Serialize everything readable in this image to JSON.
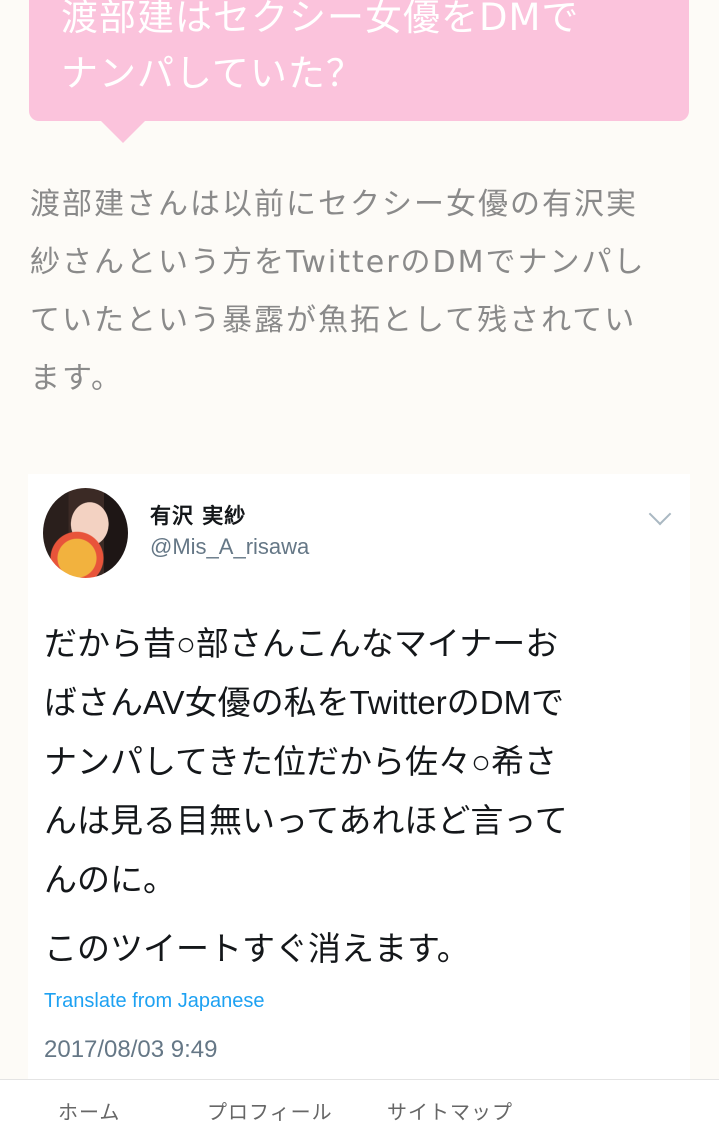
{
  "heading": {
    "lines": [
      "渡部建はセクシー女優をDMで",
      "ナンパしていた？"
    ]
  },
  "article": {
    "lines": [
      "渡部建さんは以前にセクシー女優の有沢実",
      "紗さんという方をTwitterのDMでナンパし",
      "ていたという暴露が魚拓として残されてい",
      "ます。"
    ]
  },
  "tweet": {
    "user_name": "有沢 実紗",
    "handle": "@Mis_A_risawa",
    "text_lines": [
      "だから昔○部さんこんなマイナーお",
      "ばさんAV女優の私をTwitterのDMで",
      "ナンパしてきた位だから佐々○希さ",
      "んは見る目無いってあれほど言って",
      "んのに。"
    ],
    "text_line_2": "このツイートすぐ消えます。",
    "translate_label": "Translate from Japanese",
    "timestamp": "2017/08/03 9:49",
    "colors": {
      "link": "#1da1f2",
      "muted": "#657786"
    }
  },
  "nav": {
    "items": [
      "ホーム",
      "プロフィール",
      "サイトマップ"
    ]
  },
  "colors": {
    "accent": "#fbc3dc",
    "body_text": "#8a8a8a"
  }
}
